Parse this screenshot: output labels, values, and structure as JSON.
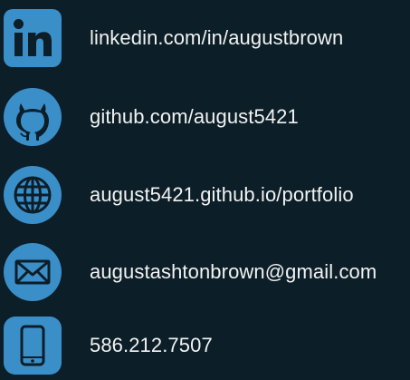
{
  "colors": {
    "background": "#0c1e28",
    "icon_fill": "#3b8fc9",
    "icon_glyph": "#0c1e28",
    "text": "#f2f2f2"
  },
  "contacts": [
    {
      "icon": "linkedin-icon",
      "label": "linkedin.com/in/augustbrown"
    },
    {
      "icon": "github-icon",
      "label": "github.com/august5421"
    },
    {
      "icon": "globe-icon",
      "label": "august5421.github.io/portfolio"
    },
    {
      "icon": "envelope-icon",
      "label": "augustashtonbrown@gmail.com"
    },
    {
      "icon": "phone-icon",
      "label": "586.212.7507"
    }
  ]
}
